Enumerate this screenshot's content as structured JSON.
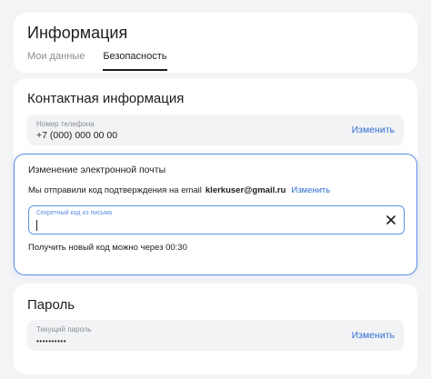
{
  "info": {
    "title": "Информация",
    "tabs": [
      {
        "label": "Мои данные",
        "active": false
      },
      {
        "label": "Безопасность",
        "active": true
      }
    ]
  },
  "contact": {
    "title": "Контактная информация",
    "phone": {
      "label": "Номер телефона",
      "value": "+7 (000) 000 00 00",
      "action": "Изменить"
    }
  },
  "email_change": {
    "title": "Изменение электронной почты",
    "message": "Мы отправили код подтверждения на email",
    "email": "klerkuser@gmail.ru",
    "change_link": "Изменить",
    "code_placeholder": "Секретный код из письма",
    "code_value": "",
    "resend_text": "Получить новый код можно через 00:30"
  },
  "password": {
    "title": "Пароль",
    "field": {
      "label": "Текущий пароль",
      "value": "••••••••••",
      "action": "Изменить"
    }
  },
  "colors": {
    "accent": "#2f6fd1",
    "focus_border": "#5b8fe0",
    "background": "#f3f4f6",
    "field_bg": "#f2f3f5"
  }
}
